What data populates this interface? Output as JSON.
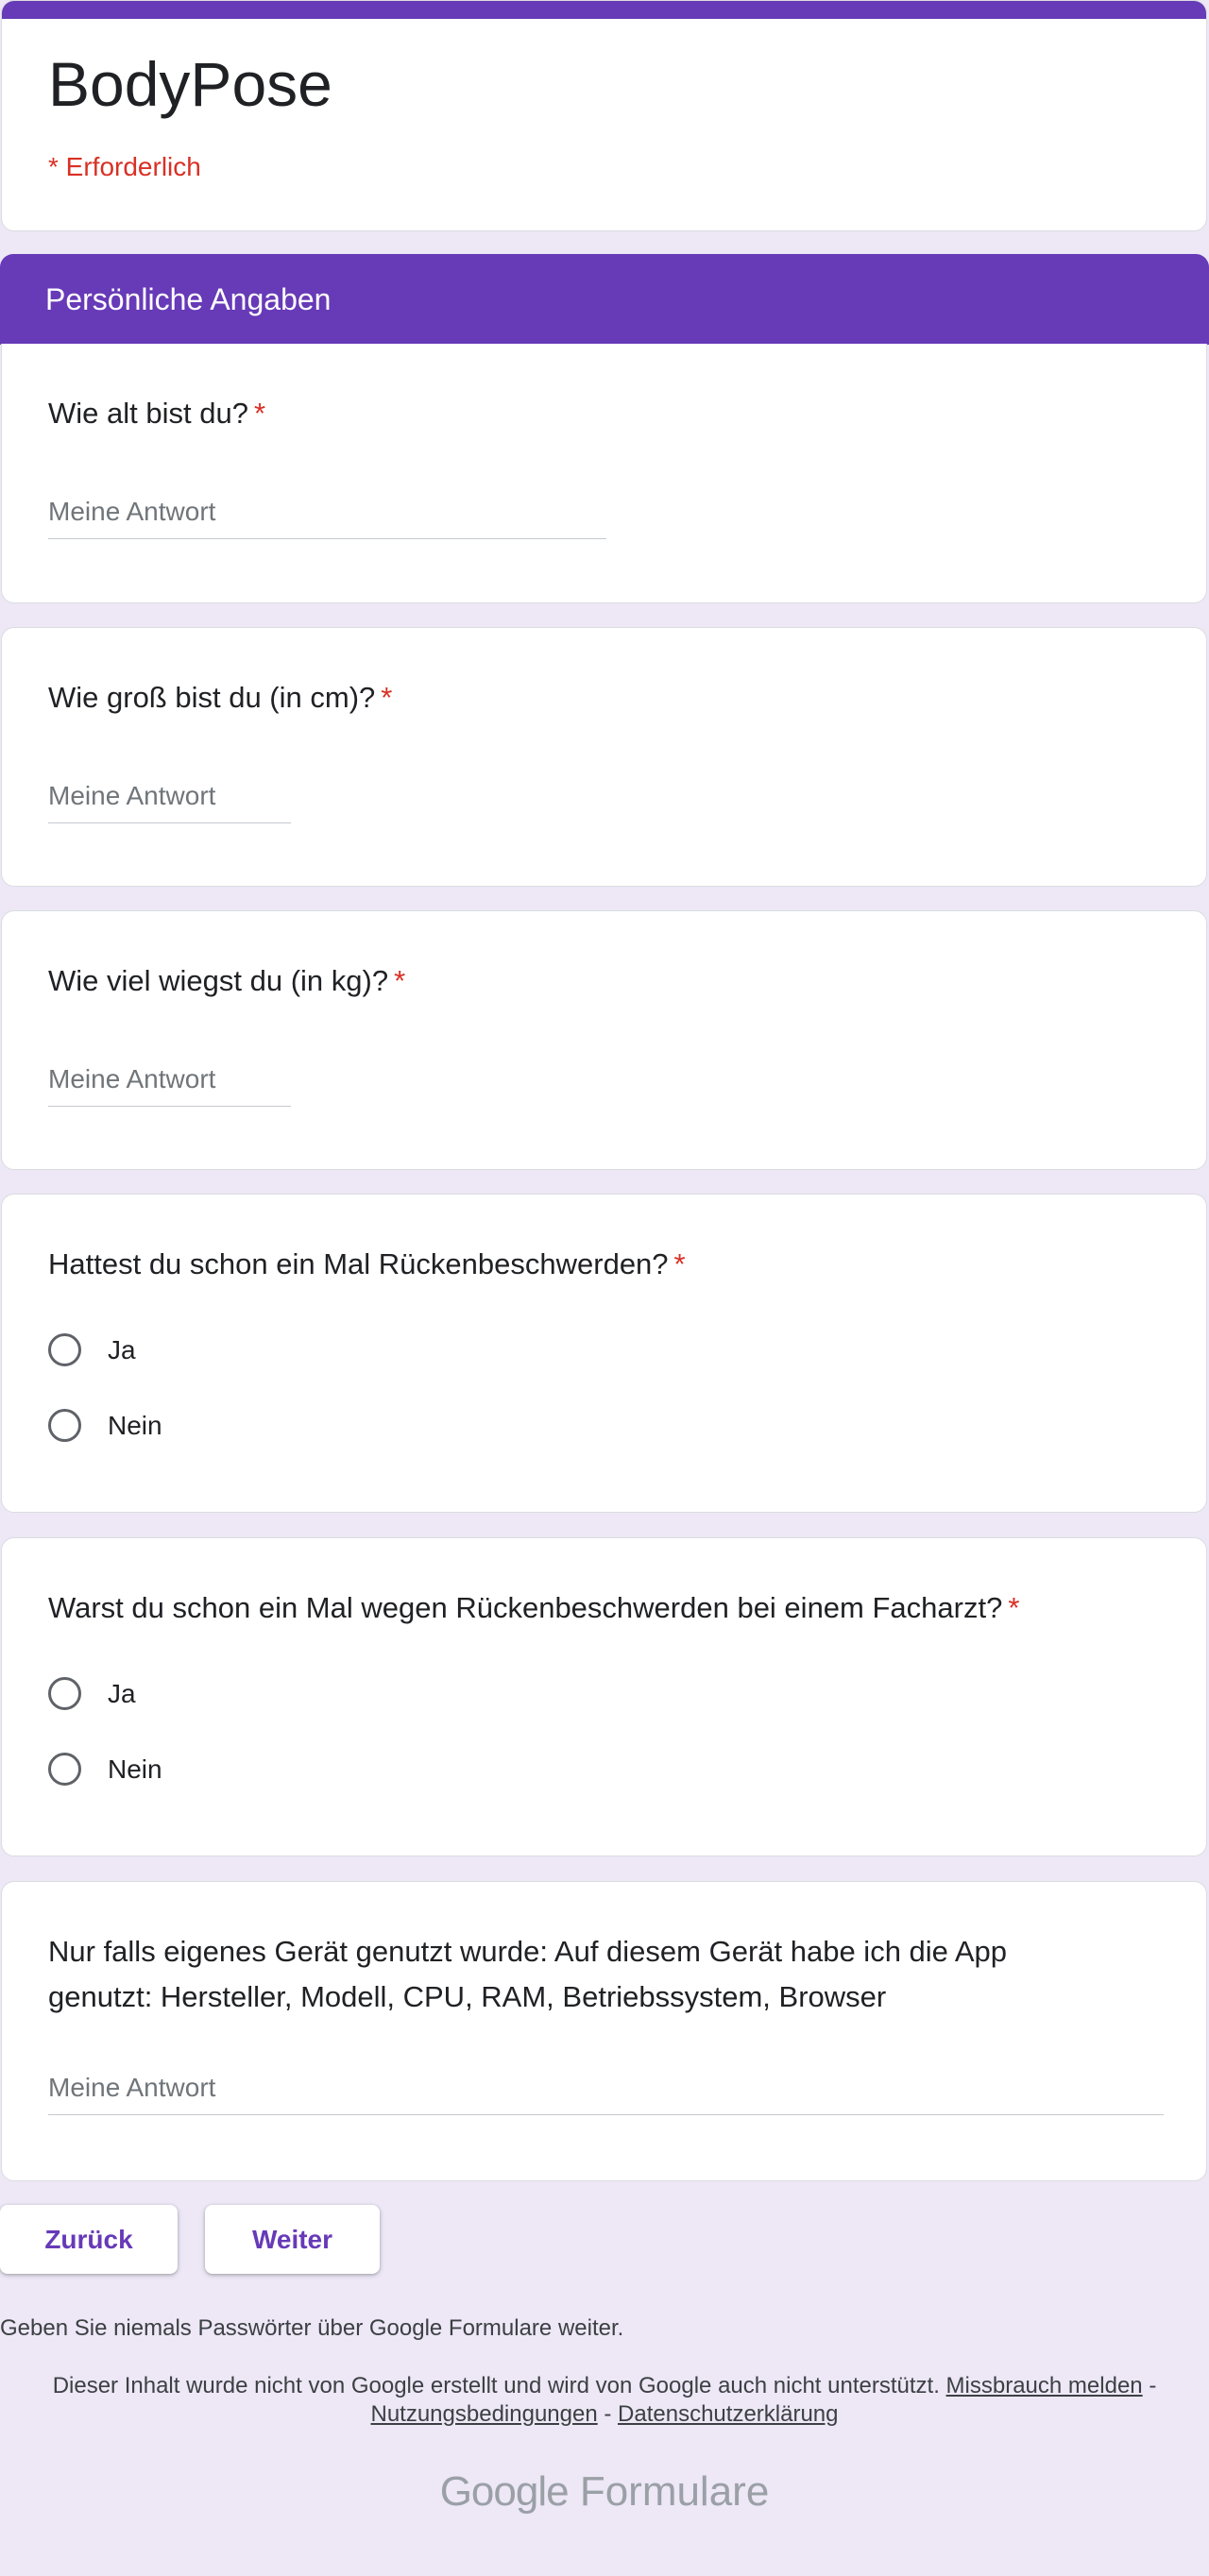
{
  "form": {
    "title": "BodyPose",
    "required_note": "* Erforderlich"
  },
  "section": {
    "title": "Persönliche Angaben"
  },
  "questions": [
    {
      "title": "Wie alt bist du?",
      "required_mark": "*",
      "type": "short-answer",
      "placeholder": "Meine Antwort"
    },
    {
      "title": "Wie groß bist du (in cm)?",
      "required_mark": "*",
      "type": "short-answer",
      "placeholder": "Meine Antwort"
    },
    {
      "title": "Wie viel wiegst du (in kg)?",
      "required_mark": "*",
      "type": "short-answer",
      "placeholder": "Meine Antwort"
    },
    {
      "title": "Hattest du schon ein Mal Rückenbeschwerden?",
      "required_mark": "*",
      "type": "radio",
      "options": [
        "Ja",
        "Nein"
      ]
    },
    {
      "title": "Warst du schon ein Mal wegen Rückenbeschwerden bei einem Facharzt?",
      "required_mark": "*",
      "type": "radio",
      "options": [
        "Ja",
        "Nein"
      ]
    },
    {
      "title_line1": "Nur falls eigenes Gerät genutzt wurde: Auf diesem Gerät habe ich die App",
      "title_line2": "genutzt: Hersteller, Modell, CPU, RAM, Betriebssystem, Browser",
      "type": "short-answer",
      "placeholder": "Meine Antwort"
    }
  ],
  "buttons": {
    "back": "Zurück",
    "next": "Weiter"
  },
  "footer": {
    "password_note": "Geben Sie niemals Passwörter über Google Formulare weiter.",
    "disclaimer": "Dieser Inhalt wurde nicht von Google erstellt und wird von Google auch nicht unterstützt.",
    "report_abuse": "Missbrauch melden",
    "separator": "-",
    "terms": "Nutzungsbedingungen",
    "privacy": "Datenschutzerklärung",
    "brand_google": "Google",
    "brand_product": "Formulare"
  },
  "colors": {
    "accent": "#673ab7",
    "background": "#ede7f6",
    "required": "#d93025"
  }
}
